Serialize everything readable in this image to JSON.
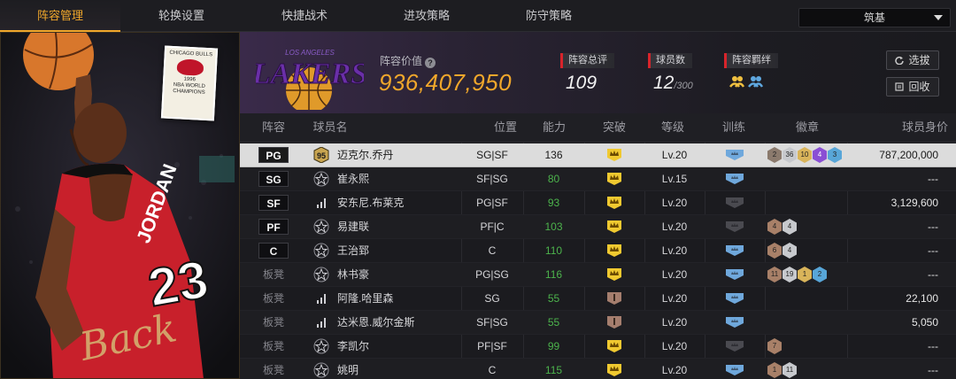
{
  "nav": {
    "tabs": [
      "阵容管理",
      "轮换设置",
      "快捷战术",
      "进攻策略",
      "防守策略"
    ],
    "active": 0,
    "select_value": "筑基"
  },
  "hero": {
    "card_title": "CHICAGO BULLS",
    "card_year": "1996",
    "card_sub": "NBA WORLD CHAMPIONS",
    "jersey_name": "JORDAN",
    "jersey_num": "23",
    "signature": "Back",
    "colors": {
      "jersey": "#c8202b",
      "accent": "#d4b070"
    }
  },
  "team": {
    "logo_top": "LOS ANGELES",
    "logo_name": "LAKERS",
    "value_label": "阵容价值",
    "value": "936,407,950"
  },
  "stats": {
    "rating_label": "阵容总评",
    "rating": "109",
    "count_label": "球员数",
    "count": "12",
    "count_max": "/300",
    "bond_label": "阵容羁绊"
  },
  "buttons": {
    "pick": "选拔",
    "recycle": "回收"
  },
  "headers": [
    "阵容",
    "球员名",
    "位置",
    "能力",
    "突破",
    "等级",
    "训练",
    "徽章",
    "球员身价"
  ],
  "rows": [
    {
      "slot": "PG",
      "starter": true,
      "ovr": "95",
      "icon": "ovr",
      "name": "迈克尔.乔丹",
      "pos": "SG|SF",
      "ability": "136",
      "ab_color": "white",
      "breakthrough": "crown",
      "level": "Lv.20",
      "train": "blue",
      "badges": [
        [
          "2",
          "b-dark"
        ],
        [
          "36",
          "b-silver"
        ],
        [
          "10",
          "b-gold"
        ],
        [
          "4",
          "b-purple"
        ],
        [
          "3",
          "b-blue"
        ]
      ],
      "salary": "787,200,000"
    },
    {
      "slot": "SG",
      "starter": true,
      "icon": "star",
      "name": "崔永熙",
      "pos": "SF|SG",
      "ability": "80",
      "ab_color": "green",
      "breakthrough": "crown",
      "level": "Lv.15",
      "train": "blue",
      "badges": [],
      "salary": "---"
    },
    {
      "slot": "SF",
      "starter": true,
      "icon": "bars",
      "name": "安东尼.布莱克",
      "pos": "PG|SF",
      "ability": "93",
      "ab_color": "green",
      "breakthrough": "crown",
      "level": "Lv.20",
      "train": "grey",
      "badges": [],
      "salary": "3,129,600"
    },
    {
      "slot": "PF",
      "starter": true,
      "icon": "star",
      "name": "易建联",
      "pos": "PF|C",
      "ability": "103",
      "ab_color": "green",
      "breakthrough": "crown",
      "level": "Lv.20",
      "train": "grey",
      "badges": [
        [
          "4",
          "b-bronze"
        ],
        [
          "4",
          "b-silver"
        ]
      ],
      "salary": "---"
    },
    {
      "slot": "C",
      "starter": true,
      "icon": "star",
      "name": "王治郅",
      "pos": "C",
      "ability": "110",
      "ab_color": "green",
      "breakthrough": "crown",
      "level": "Lv.20",
      "train": "blue",
      "badges": [
        [
          "6",
          "b-bronze"
        ],
        [
          "4",
          "b-silver"
        ]
      ],
      "salary": "---"
    },
    {
      "slot": "板凳",
      "starter": false,
      "icon": "star",
      "name": "林书豪",
      "pos": "PG|SG",
      "ability": "116",
      "ab_color": "green",
      "breakthrough": "crown",
      "level": "Lv.20",
      "train": "blue",
      "badges": [
        [
          "11",
          "b-bronze"
        ],
        [
          "19",
          "b-silver"
        ],
        [
          "1",
          "b-gold"
        ],
        [
          "2",
          "b-blue"
        ]
      ],
      "salary": "---"
    },
    {
      "slot": "板凳",
      "starter": false,
      "icon": "bars",
      "name": "阿隆.哈里森",
      "pos": "SG",
      "ability": "55",
      "ab_color": "green",
      "breakthrough": "one",
      "level": "Lv.20",
      "train": "blue",
      "badges": [],
      "salary": "22,100"
    },
    {
      "slot": "板凳",
      "starter": false,
      "icon": "bars",
      "name": "达米恩.威尔金斯",
      "pos": "SF|SG",
      "ability": "55",
      "ab_color": "green",
      "breakthrough": "one",
      "level": "Lv.20",
      "train": "blue",
      "badges": [],
      "salary": "5,050"
    },
    {
      "slot": "板凳",
      "starter": false,
      "icon": "star",
      "name": "李凯尔",
      "pos": "PF|SF",
      "ability": "99",
      "ab_color": "green",
      "breakthrough": "crown",
      "level": "Lv.20",
      "train": "grey",
      "badges": [
        [
          "7",
          "b-bronze"
        ]
      ],
      "salary": "---"
    },
    {
      "slot": "板凳",
      "starter": false,
      "icon": "star",
      "name": "姚明",
      "pos": "C",
      "ability": "115",
      "ab_color": "green",
      "breakthrough": "crown",
      "level": "Lv.20",
      "train": "blue",
      "badges": [
        [
          "1",
          "b-bronze"
        ],
        [
          "11",
          "b-silver"
        ]
      ],
      "salary": "---"
    }
  ]
}
